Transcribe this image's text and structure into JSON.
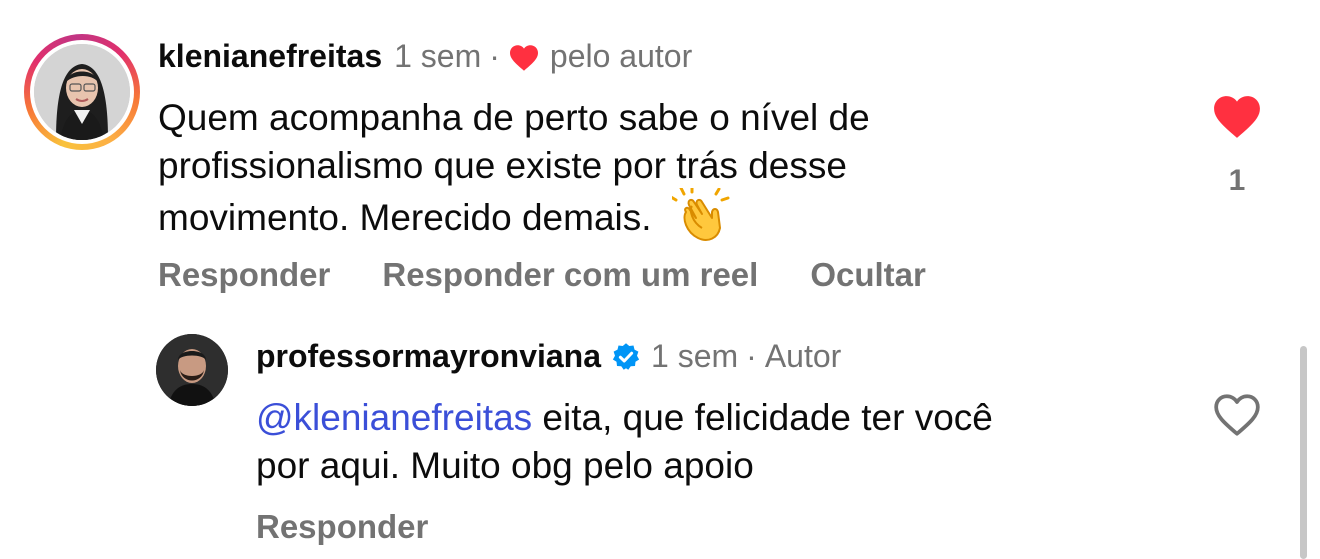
{
  "comments": [
    {
      "username": "klenianefreitas",
      "time": "1 sem",
      "separator": "·",
      "liked_by_author": "pelo autor",
      "text_lines": [
        "Quem acompanha de perto sabe o nível de",
        "profissionalismo que existe por trás desse",
        "movimento. Merecido demais."
      ],
      "like_count": "1",
      "liked": true,
      "actions": {
        "reply": "Responder",
        "reply_reel": "Responder com um reel",
        "hide": "Ocultar"
      }
    }
  ],
  "reply": {
    "username": "professormayronviana",
    "verified": true,
    "time": "1 sem",
    "separator": "·",
    "role": "Autor",
    "mention": "@klenianefreitas",
    "text_after_mention": " eita, que felicidade ter você",
    "text_line2": "por aqui. Muito obg pelo apoio",
    "liked": false,
    "actions": {
      "reply": "Responder"
    }
  },
  "colors": {
    "heart_filled": "#ff3040",
    "mention": "#3b4fd8",
    "verified": "#0095f6",
    "muted": "#737373"
  }
}
